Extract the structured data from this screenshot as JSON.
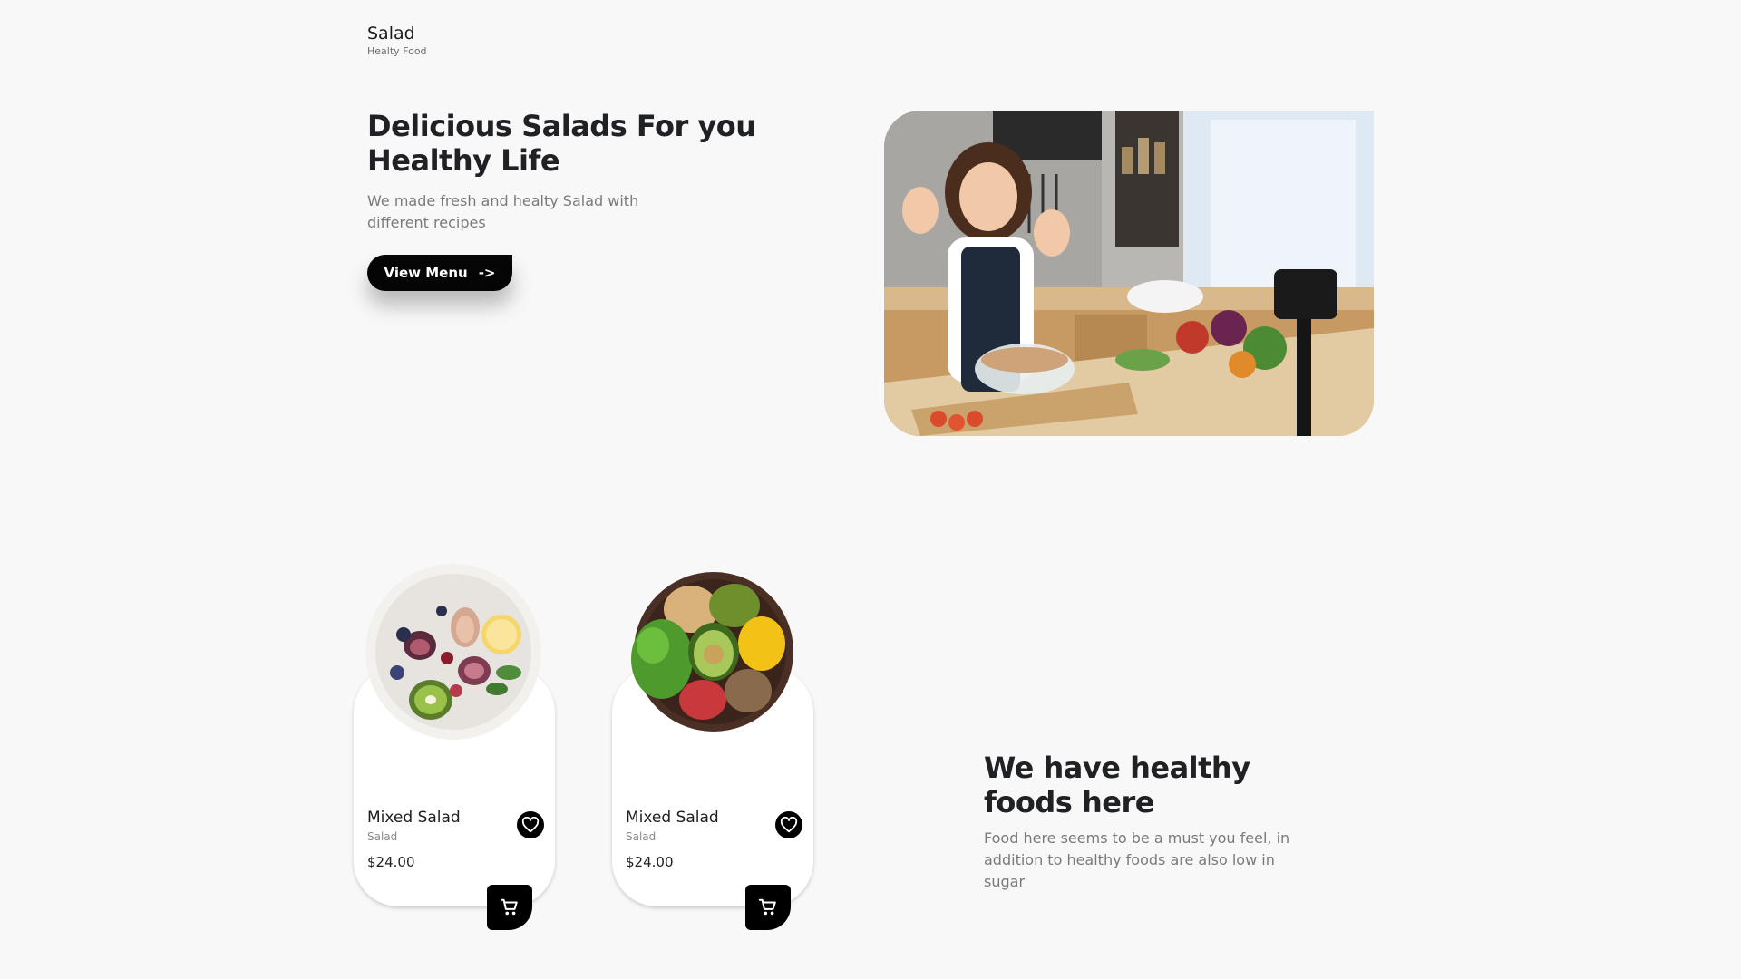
{
  "brand": {
    "title": "Salad",
    "subtitle": "Healty Food"
  },
  "hero": {
    "title": "Delicious Salads For you Healthy Life",
    "description": "We made fresh and healty Salad with different recipes",
    "button_label": "View Menu",
    "button_arrow": "->"
  },
  "products": [
    {
      "name": "Mixed Salad",
      "category": "Salad",
      "price": "$24.00"
    },
    {
      "name": "Mixed Salad",
      "category": "Salad",
      "price": "$24.00"
    }
  ],
  "info": {
    "title": "We have healthy foods here",
    "description": "Food here seems to be a must you feel, in addition to healthy foods are also low in sugar"
  },
  "icons": {
    "favorite": "heart-icon",
    "cart": "cart-icon",
    "arrow": "arrow-right-icon"
  },
  "colors": {
    "background": "#f8f8f8",
    "primary": "#000000",
    "card": "#ffffff",
    "muted_text": "#7a7a7a"
  }
}
